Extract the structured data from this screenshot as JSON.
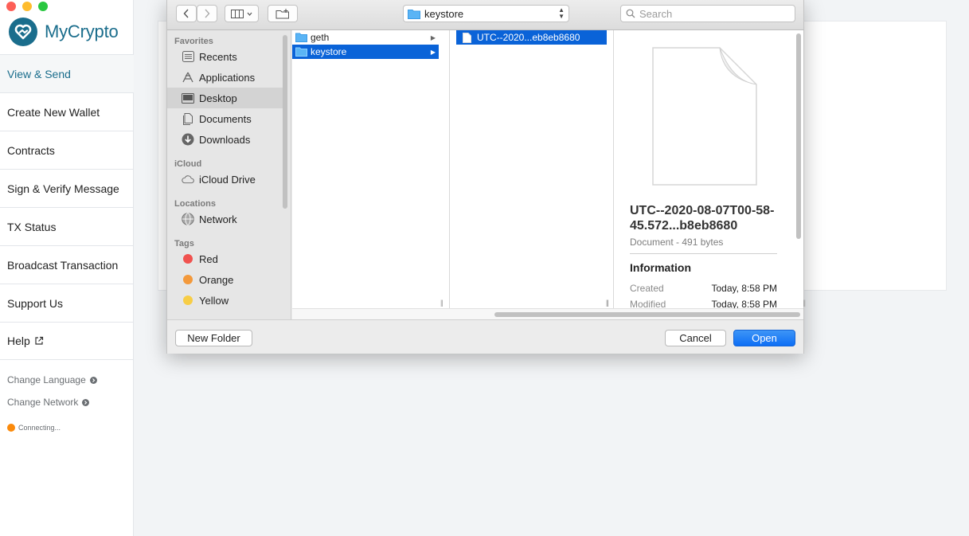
{
  "app": {
    "brand": "MyCrypto",
    "brand_color": "#1a6d8c",
    "nav": [
      {
        "label": "View & Send",
        "active": true
      },
      {
        "label": "Create New Wallet"
      },
      {
        "label": "Contracts"
      },
      {
        "label": "Sign & Verify Message"
      },
      {
        "label": "TX Status"
      },
      {
        "label": "Broadcast Transaction"
      },
      {
        "label": "Support Us"
      },
      {
        "label": "Help",
        "icon": "external-link-icon"
      }
    ],
    "change_language": "Change Language",
    "change_network": "Change Network",
    "status_text": "Connecting...",
    "status_color": "#fb8a0b"
  },
  "window_controls": {
    "close": "#fd5f57",
    "minimize": "#febc2e",
    "zoom": "#29c740"
  },
  "dialog": {
    "location": "keystore",
    "search_placeholder": "Search",
    "sidebar": {
      "favorites_heading": "Favorites",
      "favorites": [
        {
          "label": "Recents",
          "icon": "recents-icon"
        },
        {
          "label": "Applications",
          "icon": "applications-icon"
        },
        {
          "label": "Desktop",
          "icon": "desktop-icon",
          "selected": true
        },
        {
          "label": "Documents",
          "icon": "documents-icon"
        },
        {
          "label": "Downloads",
          "icon": "downloads-icon"
        }
      ],
      "icloud_heading": "iCloud",
      "icloud": [
        {
          "label": "iCloud Drive",
          "icon": "cloud-icon"
        }
      ],
      "locations_heading": "Locations",
      "locations": [
        {
          "label": "Network",
          "icon": "network-icon"
        }
      ],
      "tags_heading": "Tags",
      "tags": [
        {
          "label": "Red",
          "color": "#f0524f"
        },
        {
          "label": "Orange",
          "color": "#f3993b"
        },
        {
          "label": "Yellow",
          "color": "#f7cd46"
        }
      ]
    },
    "column1": [
      {
        "name": "geth",
        "selected": false
      },
      {
        "name": "keystore",
        "selected": true
      }
    ],
    "column2": [
      {
        "name": "UTC--2020...eb8eb8680",
        "selected": true
      }
    ],
    "preview": {
      "filename": "UTC--2020-08-07T00-58-45.572...b8eb8680",
      "kind": "Document - 491 bytes",
      "info_heading": "Information",
      "created_label": "Created",
      "created_value": "Today, 8:58 PM",
      "modified_label": "Modified",
      "modified_value": "Today, 8:58 PM"
    },
    "new_folder_label": "New Folder",
    "cancel_label": "Cancel",
    "open_label": "Open",
    "accent_color": "#0a63d8"
  }
}
